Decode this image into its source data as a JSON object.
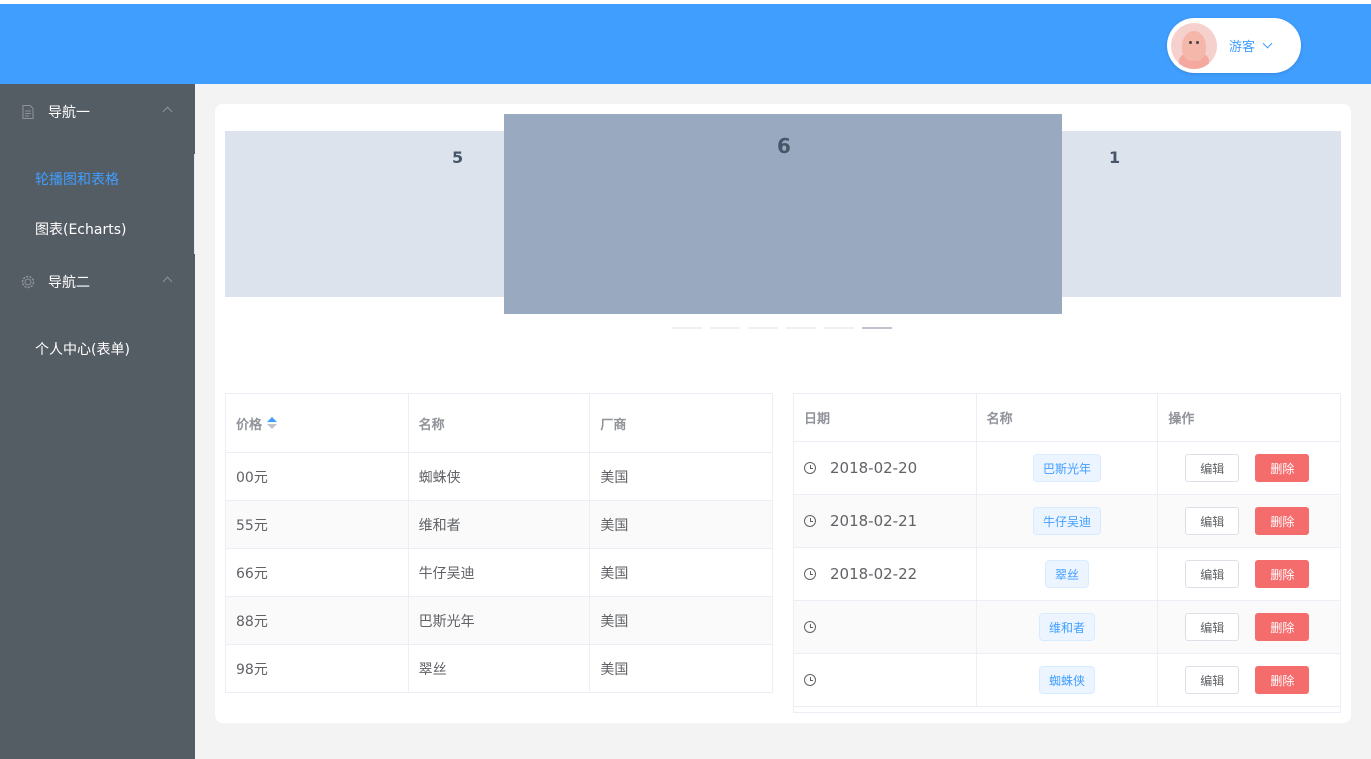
{
  "header": {
    "user_name": "游客"
  },
  "sidebar": {
    "groups": [
      {
        "label": "导航一",
        "items": [
          "轮播图和表格",
          "图表(Echarts)"
        ]
      },
      {
        "label": "导航二",
        "items": [
          "个人中心(表单)"
        ]
      }
    ],
    "active_item": "轮播图和表格"
  },
  "carousel": {
    "prev_label": "5",
    "current_label": "6",
    "next_label": "1",
    "indicator_count": 6,
    "active_index": 6
  },
  "price_table": {
    "headers": [
      "价格",
      "名称",
      "厂商"
    ],
    "sort_column": "价格",
    "rows": [
      [
        "00元",
        "蜘蛛侠",
        "美国"
      ],
      [
        "55元",
        "维和者",
        "美国"
      ],
      [
        "66元",
        "牛仔吴迪",
        "美国"
      ],
      [
        "88元",
        "巴斯光年",
        "美国"
      ],
      [
        "98元",
        "翠丝",
        "美国"
      ]
    ]
  },
  "date_table": {
    "headers": [
      "日期",
      "名称",
      "操作"
    ],
    "edit_label": "编辑",
    "delete_label": "删除",
    "rows": [
      {
        "date": "2018-02-20",
        "name": "巴斯光年"
      },
      {
        "date": "2018-02-21",
        "name": "牛仔吴迪"
      },
      {
        "date": "2018-02-22",
        "name": "翠丝"
      },
      {
        "date": "",
        "name": "维和者"
      },
      {
        "date": "",
        "name": "蜘蛛侠"
      }
    ]
  },
  "colors": {
    "primary": "#409eff",
    "sidebar_bg": "#545c64",
    "danger": "#f56c6c",
    "carousel_center": "#99a9bf",
    "carousel_side": "#dde3ec"
  }
}
